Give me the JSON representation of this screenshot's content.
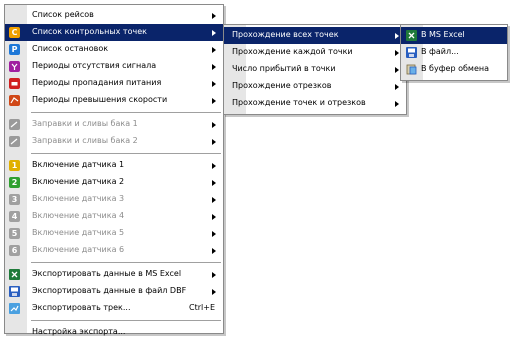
{
  "main_menu": {
    "items": [
      {
        "label": "Список рейсов",
        "type": "item",
        "arrow": true
      },
      {
        "label": "Список контрольных точек",
        "type": "item",
        "arrow": true,
        "selected": true,
        "icon": "C"
      },
      {
        "label": "Список остановок",
        "type": "item",
        "arrow": true,
        "icon": "P"
      },
      {
        "label": "Периоды отсутствия сигнала",
        "type": "item",
        "arrow": true
      },
      {
        "label": "Периоды пропадания питания",
        "type": "item",
        "arrow": true
      },
      {
        "label": "Периоды превышения скорости",
        "type": "item",
        "arrow": true
      },
      {
        "label": "Заправки и сливы бака 1",
        "type": "item",
        "arrow": true,
        "disabled": true
      },
      {
        "label": "Заправки и сливы бака 2",
        "type": "item",
        "arrow": true,
        "disabled": true
      },
      {
        "label": "Включение датчика 1",
        "type": "item",
        "arrow": true,
        "icon": "1"
      },
      {
        "label": "Включение датчика 2",
        "type": "item",
        "arrow": true,
        "icon": "2"
      },
      {
        "label": "Включение датчика 3",
        "type": "item",
        "arrow": true,
        "disabled": true,
        "icon": "3"
      },
      {
        "label": "Включение датчика 4",
        "type": "item",
        "arrow": true,
        "disabled": true,
        "icon": "4"
      },
      {
        "label": "Включение датчика 5",
        "type": "item",
        "arrow": true,
        "disabled": true,
        "icon": "5"
      },
      {
        "label": "Включение датчика 6",
        "type": "item",
        "arrow": true,
        "disabled": true,
        "icon": "6"
      },
      {
        "label": "Экспортировать данные в MS Excel",
        "type": "item",
        "arrow": true
      },
      {
        "label": "Экспортировать данные в файл DBF",
        "type": "item",
        "arrow": true
      },
      {
        "label": "Экспортировать трек...",
        "type": "item",
        "shortcut": "Ctrl+E"
      },
      {
        "label": "Настройка экспорта...",
        "type": "item"
      }
    ]
  },
  "submenu_checkpoints": {
    "items": [
      {
        "label": "Прохождение всех точек",
        "arrow": true,
        "selected": true
      },
      {
        "label": "Прохождение каждой точки",
        "arrow": true
      },
      {
        "label": "Число прибытий в точки",
        "arrow": true
      },
      {
        "label": "Прохождение отрезков",
        "arrow": true
      },
      {
        "label": "Прохождение точек и отрезков",
        "arrow": true
      }
    ]
  },
  "submenu_export": {
    "items": [
      {
        "label": "В MS Excel",
        "selected": true
      },
      {
        "label": "В файл..."
      },
      {
        "label": "В буфер обмена"
      }
    ]
  },
  "colors": {
    "selection": "#0a246a",
    "disabled_text": "#8c8c8c"
  }
}
